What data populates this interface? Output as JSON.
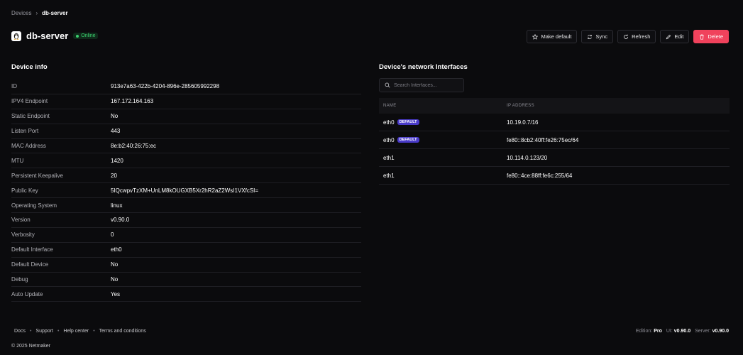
{
  "breadcrumb": {
    "parent": "Devices",
    "current": "db-server"
  },
  "device": {
    "name": "db-server",
    "status": "Online"
  },
  "actions": {
    "make_default": "Make default",
    "sync": "Sync",
    "refresh": "Refresh",
    "edit": "Edit",
    "delete": "Delete"
  },
  "device_info": {
    "title": "Device info",
    "rows": [
      {
        "key": "ID",
        "value": "913e7a63-422b-4204-896e-285605992298"
      },
      {
        "key": "IPV4 Endpoint",
        "value": "167.172.164.163"
      },
      {
        "key": "Static Endpoint",
        "value": "No"
      },
      {
        "key": "Listen Port",
        "value": "443"
      },
      {
        "key": "MAC Address",
        "value": "8e:b2:40:26:75:ec"
      },
      {
        "key": "MTU",
        "value": "1420"
      },
      {
        "key": "Persistent Keepalive",
        "value": "20"
      },
      {
        "key": "Public Key",
        "value": "5IQcwpvTzXM+UnLM8kOUGXB5Xr2hR2aZ2WsI1VXfcSI="
      },
      {
        "key": "Operating System",
        "value": "linux"
      },
      {
        "key": "Version",
        "value": "v0.90.0"
      },
      {
        "key": "Verbosity",
        "value": "0"
      },
      {
        "key": "Default Interface",
        "value": "eth0"
      },
      {
        "key": "Default Device",
        "value": "No"
      },
      {
        "key": "Debug",
        "value": "No"
      },
      {
        "key": "Auto Update",
        "value": "Yes"
      }
    ]
  },
  "interfaces": {
    "title": "Device's network Interfaces",
    "search_placeholder": "Search Interfaces...",
    "columns": {
      "name": "NAME",
      "ip": "IP ADDRESS"
    },
    "default_label": "DEFAULT",
    "rows": [
      {
        "name": "eth0",
        "is_default": true,
        "ip": "10.19.0.7/16"
      },
      {
        "name": "eth0",
        "is_default": true,
        "ip": "fe80::8cb2:40ff:fe26:75ec/64"
      },
      {
        "name": "eth1",
        "is_default": false,
        "ip": "10.114.0.123/20"
      },
      {
        "name": "eth1",
        "is_default": false,
        "ip": "fe80::4ce:88ff:fe6c:255/64"
      }
    ]
  },
  "footer": {
    "links": [
      "Docs",
      "Support",
      "Help center",
      "Terms and conditions"
    ],
    "copyright": "© 2025 Netmaker",
    "edition_label": "Edition:",
    "edition_value": "Pro",
    "ui_label": "UI:",
    "ui_value": "v0.90.0",
    "server_label": "Server:",
    "server_value": "v0.90.0"
  },
  "colors": {
    "background": "#0b0b0d",
    "online": "#3ccf6e",
    "delete": "#f0425c",
    "default_tag": "#4a3bc9"
  },
  "icons": {
    "os": "linux-tux-icon",
    "star": "star-icon",
    "sync": "sync-icon",
    "refresh": "refresh-icon",
    "edit": "pencil-icon",
    "delete": "trash-icon",
    "search": "search-icon",
    "chevron": "chevron-right-icon"
  }
}
